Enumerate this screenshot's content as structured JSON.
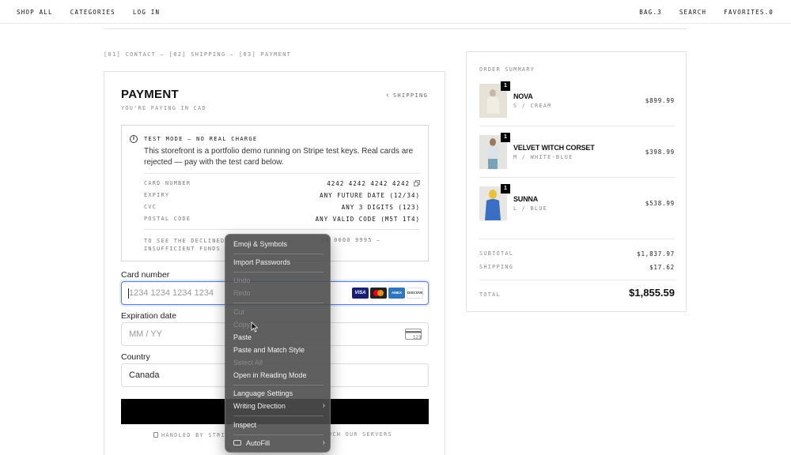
{
  "nav": {
    "left": [
      "SHOP ALL",
      "CATEGORIES",
      "LOG IN"
    ],
    "right": [
      "BAG.3",
      "SEARCH",
      "FAVORITES.0"
    ]
  },
  "steps": "[01] CONTACT — [02] SHIPPING — [03] PAYMENT",
  "payment": {
    "title": "PAYMENT",
    "subtitle": "YOU'RE PAYING IN CAD",
    "back_label": "SHIPPING",
    "test_mode": {
      "heading": "TEST MODE — NO REAL CHARGE",
      "description": "This storefront is a portfolio demo running on Stripe test keys. Real cards are rejected — pay with the test card below.",
      "rows": [
        {
          "k": "CARD NUMBER",
          "v": "4242 4242 4242 4242"
        },
        {
          "k": "EXPIRY",
          "v": "ANY FUTURE DATE (12/34)"
        },
        {
          "k": "CVC",
          "v": "ANY 3 DIGITS (123)"
        },
        {
          "k": "POSTAL CODE",
          "v": "ANY VALID CODE (M5T 1T4)"
        }
      ],
      "decline_line1": "TO SEE THE DECLINED",
      "decline_line1_end": "00 0000 9995 —",
      "decline_line2": "INSUFFICIENT FUNDS"
    },
    "card_number": {
      "label": "Card number",
      "placeholder": "1234 1234 1234 1234"
    },
    "brands": [
      "VISA",
      "MC",
      "AMEX",
      "DISCOVER"
    ],
    "expiry": {
      "label": "Expiration date",
      "placeholder": "MM / YY",
      "cvc_icon_text": "123"
    },
    "country": {
      "label": "Country",
      "value": "Canada"
    },
    "handled_start": "HANDLED BY STRI",
    "handled_end": "UCH OUR SERVERS"
  },
  "summary": {
    "title": "ORDER SUMMARY",
    "items": [
      {
        "qty": "1",
        "name": "NOVA",
        "variant": "S / CREAM",
        "price": "$899.99"
      },
      {
        "qty": "1",
        "name": "VELVET WITCH CORSET",
        "variant": "M / WHITE-BLUE",
        "price": "$398.99"
      },
      {
        "qty": "1",
        "name": "SUNNA",
        "variant": "L / BLUE",
        "price": "$538.99"
      }
    ],
    "subtotal_label": "SUBTOTAL",
    "subtotal": "$1,837.97",
    "shipping_label": "SHIPPING",
    "shipping": "$17.62",
    "total_label": "TOTAL",
    "total": "$1,855.59"
  },
  "context_menu": {
    "items": [
      {
        "label": "Emoji & Symbols",
        "disabled": false
      },
      {
        "label": "Import Passwords",
        "disabled": false
      },
      {
        "label": "Undo",
        "disabled": true
      },
      {
        "label": "Redo",
        "disabled": true
      },
      {
        "label": "Cut",
        "disabled": true
      },
      {
        "label": "Copy",
        "disabled": true
      },
      {
        "label": "Paste",
        "disabled": false
      },
      {
        "label": "Paste and Match Style",
        "disabled": false
      },
      {
        "label": "Select All",
        "disabled": true
      },
      {
        "label": "Open in Reading Mode",
        "disabled": false
      },
      {
        "label": "Language Settings",
        "disabled": false
      },
      {
        "label": "Writing Direction",
        "disabled": false
      },
      {
        "label": "Inspect",
        "disabled": false
      },
      {
        "label": "AutoFill",
        "disabled": false
      }
    ]
  }
}
